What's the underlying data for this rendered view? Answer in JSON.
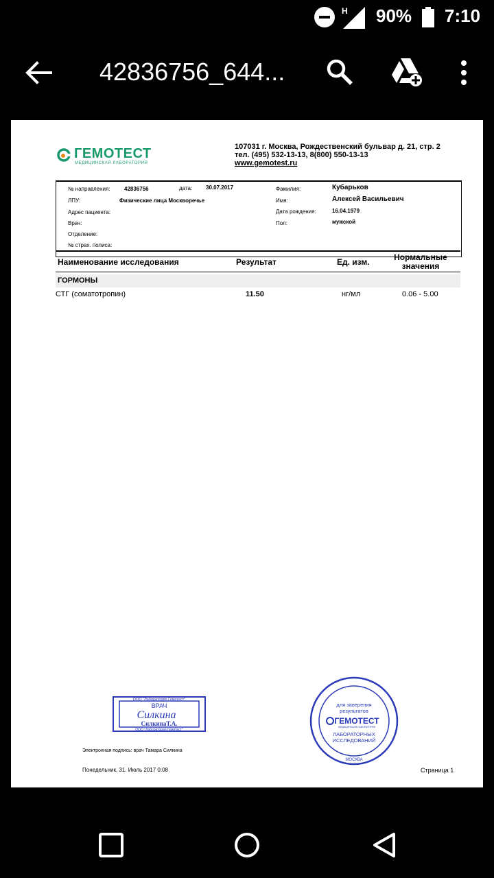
{
  "status": {
    "battery": "90%",
    "time": "7:10",
    "network": "H"
  },
  "appbar": {
    "title": "42836756_644..."
  },
  "doc": {
    "brand": "ГЕМОТЕСТ",
    "brand_tag": "МЕДИЦИНСКАЯ ЛАБОРАТОРИЯ",
    "address": "107031 г. Москва, Рождественский бульвар д. 21, стр. 2",
    "phones": "тел. (495) 532-13-13, 8(800) 550-13-13",
    "website": "www.gemotest.ru",
    "fields": {
      "referral_label": "№ направления:",
      "referral_value": "42836756",
      "date_label": "дата:",
      "date_value": "30.07.2017",
      "lpu_label": "ЛПУ:",
      "lpu_value": "Физические лица Москворечье",
      "address_label": "Адрес пациента:",
      "doctor_label": "Врач:",
      "department_label": "Отделение:",
      "policy_label": "№ страх. полиса:",
      "surname_label": "Фамилия:",
      "surname_value": "Кубарьков",
      "name_label": "Имя:",
      "name_value": "Алексей Васильевич",
      "dob_label": "Дата рождения:",
      "dob_value": "16.04.1979",
      "sex_label": "Пол:",
      "sex_value": "мужской"
    },
    "table": {
      "headers": {
        "test": "Наименование исследования",
        "result": "Результат",
        "unit": "Ед. изм.",
        "norm_line1": "Нормальные",
        "norm_line2": "значения"
      },
      "section": "ГОРМОНЫ",
      "rows": [
        {
          "test": "СТГ (соматотропин)",
          "result": "11.50",
          "unit": "нг/мл",
          "norm": "0.06 - 5.00"
        }
      ]
    },
    "stamp_rect": {
      "top": "ООО \"Лаборатория Гемотест\"",
      "title": "ВРАЧ",
      "signature": "Силкина",
      "name": "СилкинаТ.А.",
      "bottom": "ООО \"Лаборатория Гемотест\""
    },
    "stamp_round": {
      "line1": "для заверения",
      "line2": "результатов",
      "brand": "ГЕМОТЕСТ",
      "tag": "МЕДИЦИНСКАЯ ЛАБОРАТОРИЯ",
      "line3": "ЛАБОРАТОРНЫХ",
      "line4": "ИССЛЕДОВАНИЙ",
      "city": "МОСКВА"
    },
    "e_signature": "Электронная подпись: врач Тамара Силкина",
    "printed_date": "Понедельник, 31. Июль 2017 0:08",
    "page": "Страница 1"
  },
  "colors": {
    "brand_green": "#1a9a6a",
    "stamp_blue": "#2a3ab8"
  }
}
